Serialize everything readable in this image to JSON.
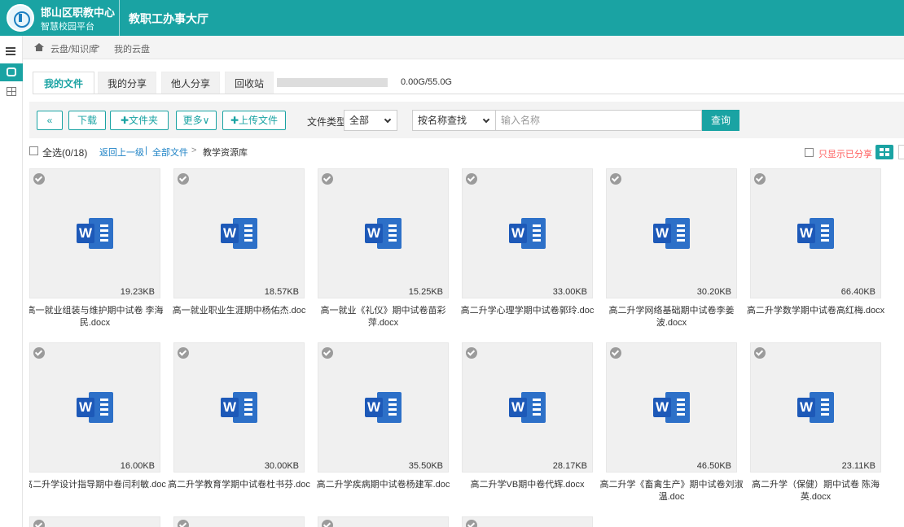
{
  "header": {
    "brand_title": "邯山区职教中心",
    "brand_sub": "智慧校园平台",
    "app_name": "教职工办事大厅"
  },
  "breadcrumb": {
    "items": [
      "云盘/知识库",
      ">",
      "我的云盘"
    ]
  },
  "tabs": [
    {
      "label": "我的文件",
      "active": true
    },
    {
      "label": "我的分享",
      "active": false
    },
    {
      "label": "他人分享",
      "active": false
    },
    {
      "label": "回收站",
      "active": false
    }
  ],
  "storage": {
    "used_label": "0.00G/55.0G",
    "fraction": 0.0
  },
  "toolbar": {
    "back": "«",
    "download": "下载",
    "new_folder": "✚文件夹",
    "more": "更多∨",
    "upload": "✚上传文件",
    "filetype_label": "文件类型",
    "filetype_value": "全部",
    "search_mode": "按名称查找",
    "search_placeholder": "输入名称",
    "search_button": "查询"
  },
  "subbar": {
    "select_all": "全选(0/18)",
    "up_level": "返回上一级",
    "sep": "|",
    "all_files": "全部文件",
    "arrow": ">",
    "current": "教学资源库",
    "show_shared": "只显示已分享"
  },
  "files": [
    {
      "name": "高一就业组装与维护期中试卷 李海民.docx",
      "size": "19.23KB"
    },
    {
      "name": "高一就业职业生涯期中杨佑杰.doc",
      "size": "18.57KB"
    },
    {
      "name": "高一就业《礼仪》期中试卷苗彩萍.docx",
      "size": "15.25KB"
    },
    {
      "name": "高二升学心理学期中试卷郭玲.doc",
      "size": "33.00KB"
    },
    {
      "name": "高二升学网络基础期中试卷李姜波.docx",
      "size": "30.20KB"
    },
    {
      "name": "高二升学数学期中试卷高红梅.docx",
      "size": "66.40KB"
    },
    {
      "name": "高二升学设计指导期中卷闫利敏.doc",
      "size": "16.00KB"
    },
    {
      "name": "高二升学教育学期中试卷杜书芬.doc",
      "size": "30.00KB"
    },
    {
      "name": "高二升学疾病期中试卷杨建军.doc",
      "size": "35.50KB"
    },
    {
      "name": "高二升学VB期中卷代辉.docx",
      "size": "28.17KB"
    },
    {
      "name": "高二升学《畜禽生产》期中试卷刘淑温.doc",
      "size": "46.50KB"
    },
    {
      "name": "高二升学（保健）期中试卷 陈海英.docx",
      "size": "23.11KB"
    }
  ]
}
